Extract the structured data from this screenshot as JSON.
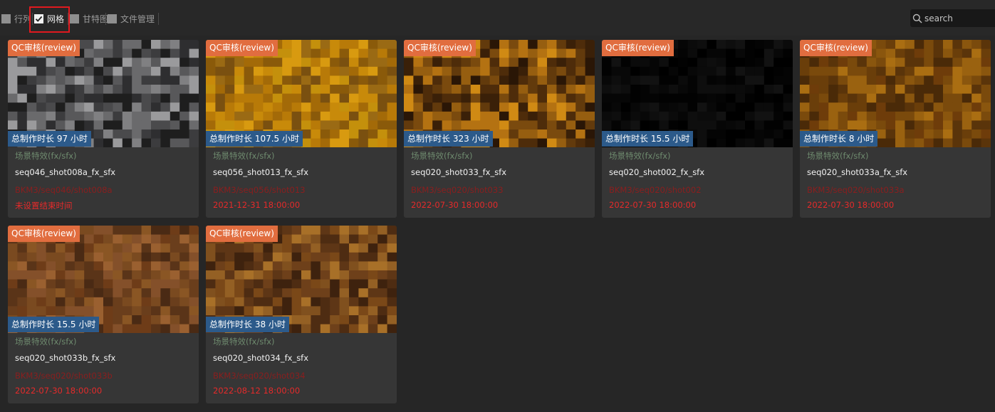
{
  "toolbar": {
    "views": [
      {
        "label": "行列",
        "checked": false
      },
      {
        "label": "网格",
        "checked": true
      },
      {
        "label": "甘特图",
        "checked": false
      },
      {
        "label": "文件管理",
        "checked": false
      }
    ],
    "search_placeholder": "search"
  },
  "colors": {
    "status_badge": "#e16d3f",
    "duration_badge": "#2c5a8a",
    "department_text": "#6e8a6e",
    "path_text": "#8a1e1e",
    "deadline_text": "#e52a2a",
    "highlight": "#e0191f"
  },
  "cards": [
    {
      "status": "QC审核(review)",
      "duration": "总制作时长 97 小时",
      "department": "场景特效(fx/sfx)",
      "name": "seq046_shot008a_fx_sfx",
      "path": "BKM3/seq046/shot008a",
      "deadline": "未设置结束时间",
      "thumb_palette": [
        "#1e1e1e",
        "#2e2e30",
        "#3c3c3e",
        "#4a4a4c",
        "#58585a",
        "#6a6a6c",
        "#808082",
        "#9a9a9c"
      ]
    },
    {
      "status": "QC审核(review)",
      "duration": "总制作时长 107.5 小时",
      "department": "场景特效(fx/sfx)",
      "name": "seq056_shot013_fx_sfx",
      "path": "BKM3/seq056/shot013",
      "deadline": "2021-12-31 18:00:00",
      "thumb_palette": [
        "#8a5a0a",
        "#a36a08",
        "#b87a08",
        "#c88a0a",
        "#d89a10",
        "#9a6a14",
        "#7a5010",
        "#c4900c"
      ]
    },
    {
      "status": "QC审核(review)",
      "duration": "总制作时长 323 小时",
      "department": "场景特效(fx/sfx)",
      "name": "seq020_shot033_fx_sfx",
      "path": "BKM3/seq020/shot033",
      "deadline": "2022-07-30 18:00:00",
      "thumb_palette": [
        "#2a1606",
        "#3a2008",
        "#4e2c0a",
        "#623a0c",
        "#7a4a0e",
        "#965e10",
        "#b47212",
        "#d08a14"
      ]
    },
    {
      "status": "QC审核(review)",
      "duration": "总制作时长 15.5 小时",
      "department": "场景特效(fx/sfx)",
      "name": "seq020_shot002_fx_sfx",
      "path": "BKM3/seq020/shot002",
      "deadline": "2022-07-30 18:00:00",
      "thumb_palette": [
        "#000000",
        "#020202",
        "#040404",
        "#060606",
        "#080808",
        "#0b0b0b",
        "#0e0e0e",
        "#121212"
      ]
    },
    {
      "status": "QC审核(review)",
      "duration": "总制作时长 8 小时",
      "department": "场景特效(fx/sfx)",
      "name": "seq020_shot033a_fx_sfx",
      "path": "BKM3/seq020/shot033a",
      "deadline": "2022-07-30 18:00:00",
      "thumb_palette": [
        "#4a2a08",
        "#5a340a",
        "#6a3e0a",
        "#7a4a0c",
        "#8a560e",
        "#9a6210",
        "#aa6e12",
        "#6e3c0a"
      ]
    },
    {
      "status": "QC审核(review)",
      "duration": "总制作时长 15.5 小时",
      "department": "场景特效(fx/sfx)",
      "name": "seq020_shot033b_fx_sfx",
      "path": "BKM3/seq020/shot033b",
      "deadline": "2022-07-30 18:00:00",
      "thumb_palette": [
        "#4a2a14",
        "#5a3418",
        "#6a3e1c",
        "#7a4a20",
        "#8a5624",
        "#6e3c18",
        "#84502a",
        "#9a6030"
      ]
    },
    {
      "status": "QC审核(review)",
      "duration": "总制作时长 38 小时",
      "department": "场景特效(fx/sfx)",
      "name": "seq020_shot034_fx_sfx",
      "path": "BKM3/seq020/shot034",
      "deadline": "2022-08-12 18:00:00",
      "thumb_palette": [
        "#3e220e",
        "#4e2c12",
        "#5e3616",
        "#6e401a",
        "#80501e",
        "#946024",
        "#a87028",
        "#7a4818"
      ]
    }
  ]
}
